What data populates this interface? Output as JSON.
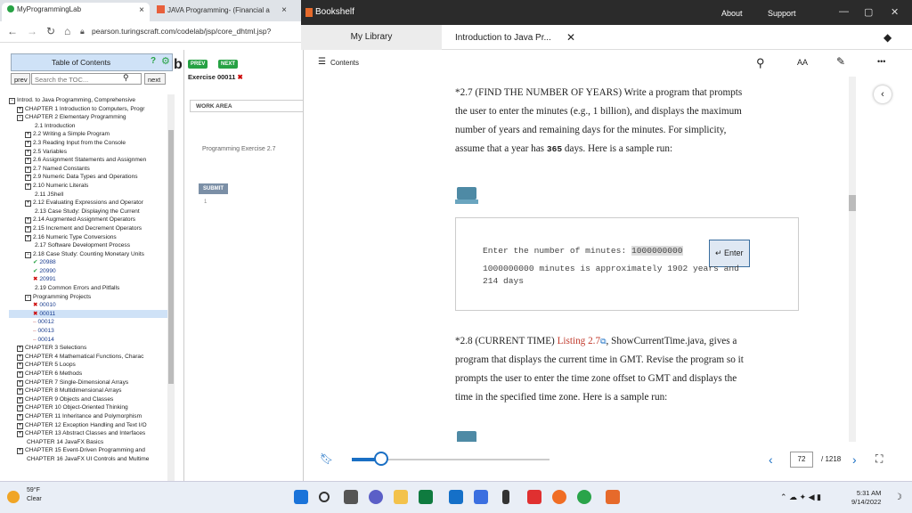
{
  "browser": {
    "tabs": [
      {
        "label": "MyProgrammingLab"
      },
      {
        "label": "JAVA Programming- (Financial a"
      }
    ],
    "url": "pearson.turingscraft.com/codelab/jsp/core_dhtml.jsp?"
  },
  "bookshelf": {
    "app_title": "Bookshelf",
    "menu_about": "About",
    "menu_support": "Support",
    "tab_mylibrary": "My Library",
    "tab_book": "Introduction to Java Pr...",
    "contents_label": "Contents",
    "font_label": "AA",
    "more_label": "•••"
  },
  "toc": {
    "header": "Table of Contents",
    "prev": "prev",
    "search_placeholder": "Search the TOC...",
    "next": "next",
    "items": [
      {
        "t": "Introd. to Java Programming, Comprehensive",
        "i": 0,
        "b": "−"
      },
      {
        "t": "CHAPTER 1 Introduction to Computers, Progr",
        "i": 1,
        "b": "+"
      },
      {
        "t": "CHAPTER 2 Elementary Programming",
        "i": 1,
        "b": "−"
      },
      {
        "t": "2.1 Introduction",
        "i": 2,
        "b": ""
      },
      {
        "t": "2.2 Writing a Simple Program",
        "i": 2,
        "b": "+"
      },
      {
        "t": "2.3 Reading Input from the Console",
        "i": 2,
        "b": "+"
      },
      {
        "t": "2.5 Variables",
        "i": 2,
        "b": "+"
      },
      {
        "t": "2.6 Assignment Statements and Assignmen",
        "i": 2,
        "b": "+"
      },
      {
        "t": "2.7 Named Constants",
        "i": 2,
        "b": "+"
      },
      {
        "t": "2.9 Numeric Data Types and Operations",
        "i": 2,
        "b": "+"
      },
      {
        "t": "2.10 Numeric Literals",
        "i": 2,
        "b": "+"
      },
      {
        "t": "2.11 JShell",
        "i": 2,
        "b": ""
      },
      {
        "t": "2.12 Evaluating Expressions and Operator",
        "i": 2,
        "b": "+"
      },
      {
        "t": "2.13 Case Study: Displaying the Current",
        "i": 2,
        "b": ""
      },
      {
        "t": "2.14 Augmented Assignment Operators",
        "i": 2,
        "b": "+"
      },
      {
        "t": "2.15 Increment and Decrement Operators",
        "i": 2,
        "b": "+"
      },
      {
        "t": "2.16 Numeric Type Conversions",
        "i": 2,
        "b": "+"
      },
      {
        "t": "2.17 Software Development Process",
        "i": 2,
        "b": ""
      },
      {
        "t": "2.18 Case Study: Counting Monetary Units",
        "i": 2,
        "b": "−"
      },
      {
        "t": "20988",
        "i": 3,
        "s": "ok"
      },
      {
        "t": "20990",
        "i": 3,
        "s": "ok"
      },
      {
        "t": "20991",
        "i": 3,
        "s": "bad"
      },
      {
        "t": "2.19 Common Errors and Pitfalls",
        "i": 2,
        "b": ""
      },
      {
        "t": "Programming Projects",
        "i": 2,
        "b": "−"
      },
      {
        "t": "00010",
        "i": 3,
        "s": "bad"
      },
      {
        "t": "00011",
        "i": 3,
        "s": "bad",
        "sel": true
      },
      {
        "t": "00012",
        "i": 3,
        "s": "dash"
      },
      {
        "t": "00013",
        "i": 3,
        "s": "dash"
      },
      {
        "t": "00014",
        "i": 3,
        "s": "dash"
      },
      {
        "t": "CHAPTER 3 Selections",
        "i": 1,
        "b": "+"
      },
      {
        "t": "CHAPTER 4 Mathematical Functions, Charac",
        "i": 1,
        "b": "+"
      },
      {
        "t": "CHAPTER 5 Loops",
        "i": 1,
        "b": "+"
      },
      {
        "t": "CHAPTER 6 Methods",
        "i": 1,
        "b": "+"
      },
      {
        "t": "CHAPTER 7 Single-Dimensional Arrays",
        "i": 1,
        "b": "+"
      },
      {
        "t": "CHAPTER 8 Multidimensional Arrays",
        "i": 1,
        "b": "+"
      },
      {
        "t": "CHAPTER 9 Objects and Classes",
        "i": 1,
        "b": "+"
      },
      {
        "t": "CHAPTER 10 Object-Oriented Thinking",
        "i": 1,
        "b": "+"
      },
      {
        "t": "CHAPTER 11 Inheritance and Polymorphism",
        "i": 1,
        "b": "+"
      },
      {
        "t": "CHAPTER 12 Exception Handling and Text I/O",
        "i": 1,
        "b": "+"
      },
      {
        "t": "CHAPTER 13 Abstract Classes and Interfaces",
        "i": 1,
        "b": "+"
      },
      {
        "t": "CHAPTER 14 JavaFX Basics",
        "i": 1,
        "b": ""
      },
      {
        "t": "CHAPTER 15 Event-Driven Programming and",
        "i": 1,
        "b": "+"
      },
      {
        "t": "CHAPTER 16 JavaFX UI Controls and Multime",
        "i": 1,
        "b": ""
      }
    ]
  },
  "codelab": {
    "prev_btn": "PREV",
    "next_btn": "NEXT",
    "exercise": "Exercise 00011",
    "work_area": "WORK AREA",
    "programming_exercise": "Programming Exercise 2.7",
    "submit": "SUBMIT",
    "line_no": "1"
  },
  "book": {
    "p1_lines": [
      "*2.7 (FIND THE NUMBER OF YEARS) Write a program that prompts",
      "the user to enter the minutes (e.g., 1 billion), and displays the maximum",
      "number of years and remaining days for the minutes. For simplicity,"
    ],
    "p1_last_a": "assume that a year has ",
    "p1_last_code": "365",
    "p1_last_b": " days. Here is a sample run:",
    "sample_prompt": "Enter the number of minutes: ",
    "sample_input": "1000000000",
    "enter_label": "Enter",
    "sample_out1": "1000000000 minutes is approximately 1902 years and",
    "sample_out2": "214 days",
    "p2_head": "*2.8 (CURRENT TIME) ",
    "p2_link": "Listing 2.7",
    "p2_head_rest": ", ShowCurrentTime.java, gives a",
    "p2_lines": [
      "program that displays the current time in GMT. Revise the program so it",
      "prompts the user to enter the time zone offset to GMT and displays the",
      "time in the specified time zone. Here is a sample run:"
    ]
  },
  "reader_footer": {
    "page_current": "72",
    "page_total": "/ 1218",
    "progress": 0.06
  },
  "taskbar": {
    "temp": "59°F",
    "condition": "Clear",
    "time": "5:31 AM",
    "date": "9/14/2022"
  },
  "colors": {
    "accent": "#1a6fc4",
    "codelab_green": "#27a244"
  }
}
